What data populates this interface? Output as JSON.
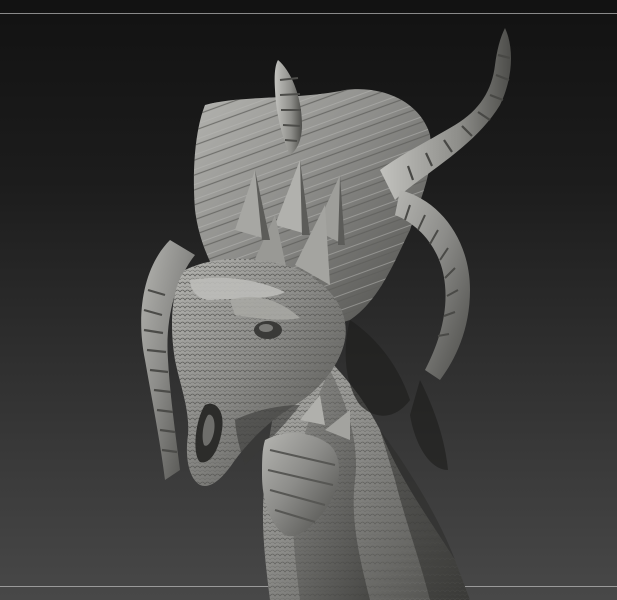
{
  "viewport": {
    "background_top": "#121212",
    "background_bottom": "#484848",
    "frame_line_color": "#8a8a8a"
  },
  "model": {
    "subject": "dragon-head-sculpt",
    "material_base": "#8c8c89",
    "material_highlight": "#c9c9c4",
    "material_shadow": "#2a2a28"
  }
}
